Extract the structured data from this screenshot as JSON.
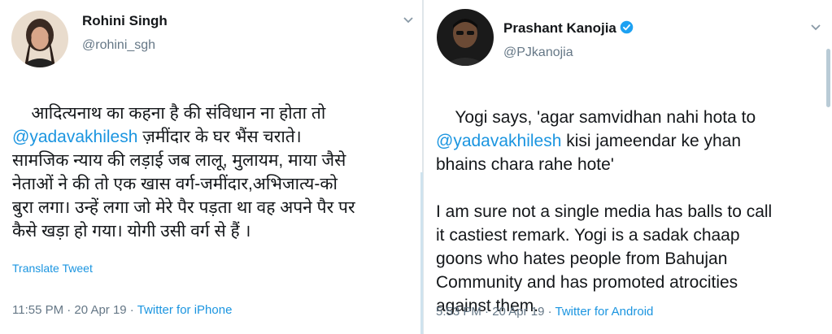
{
  "left_tweet": {
    "name": "Rohini Singh",
    "handle": "@rohini_sgh",
    "text_line1": "आदित्यनाथ का कहना है की संविधान ना होता तो",
    "mention": "@yadavakhilesh",
    "text_line2_rest": " ज़मींदार के घर भैंस चराते।",
    "text_rest": "सामजिक न्याय की लड़ाई जब लालू, मुलायम, माया जैसे\nनेताओं ने की तो एक खास वर्ग-जमींदार,अभिजात्य-को\nबुरा लगा। उन्हें लगा जो मेरे पैर पड़ता था वह अपने पैर पर\nकैसे खड़ा हो गया। योगी उसी वर्ग से हैं ।",
    "translate_label": "Translate Tweet",
    "timestamp": "11:55 PM · 20 Apr 19 · ",
    "source": "Twitter for iPhone"
  },
  "right_tweet": {
    "name": "Prashant Kanojia",
    "handle": "@PJkanojia",
    "verified_icon": "verified-badge-icon",
    "text_line1": "Yogi says, 'agar samvidhan nahi hota to",
    "mention": "@yadavakhilesh",
    "text_line2_rest": " kisi jameendar ke yhan",
    "text_rest": "bhains chara rahe hote'\n\nI am sure not a single media has balls to call\nit castiest remark. Yogi is a sadak chaap\ngoons who hates people from Bahujan\nCommunity and has promoted atrocities\nagainst them.",
    "timestamp": "5:53 PM · 20 Apr 19 · ",
    "source": "Twitter for Android"
  },
  "colors": {
    "link": "#1b95e0",
    "text": "#14171a",
    "muted": "#657786"
  }
}
